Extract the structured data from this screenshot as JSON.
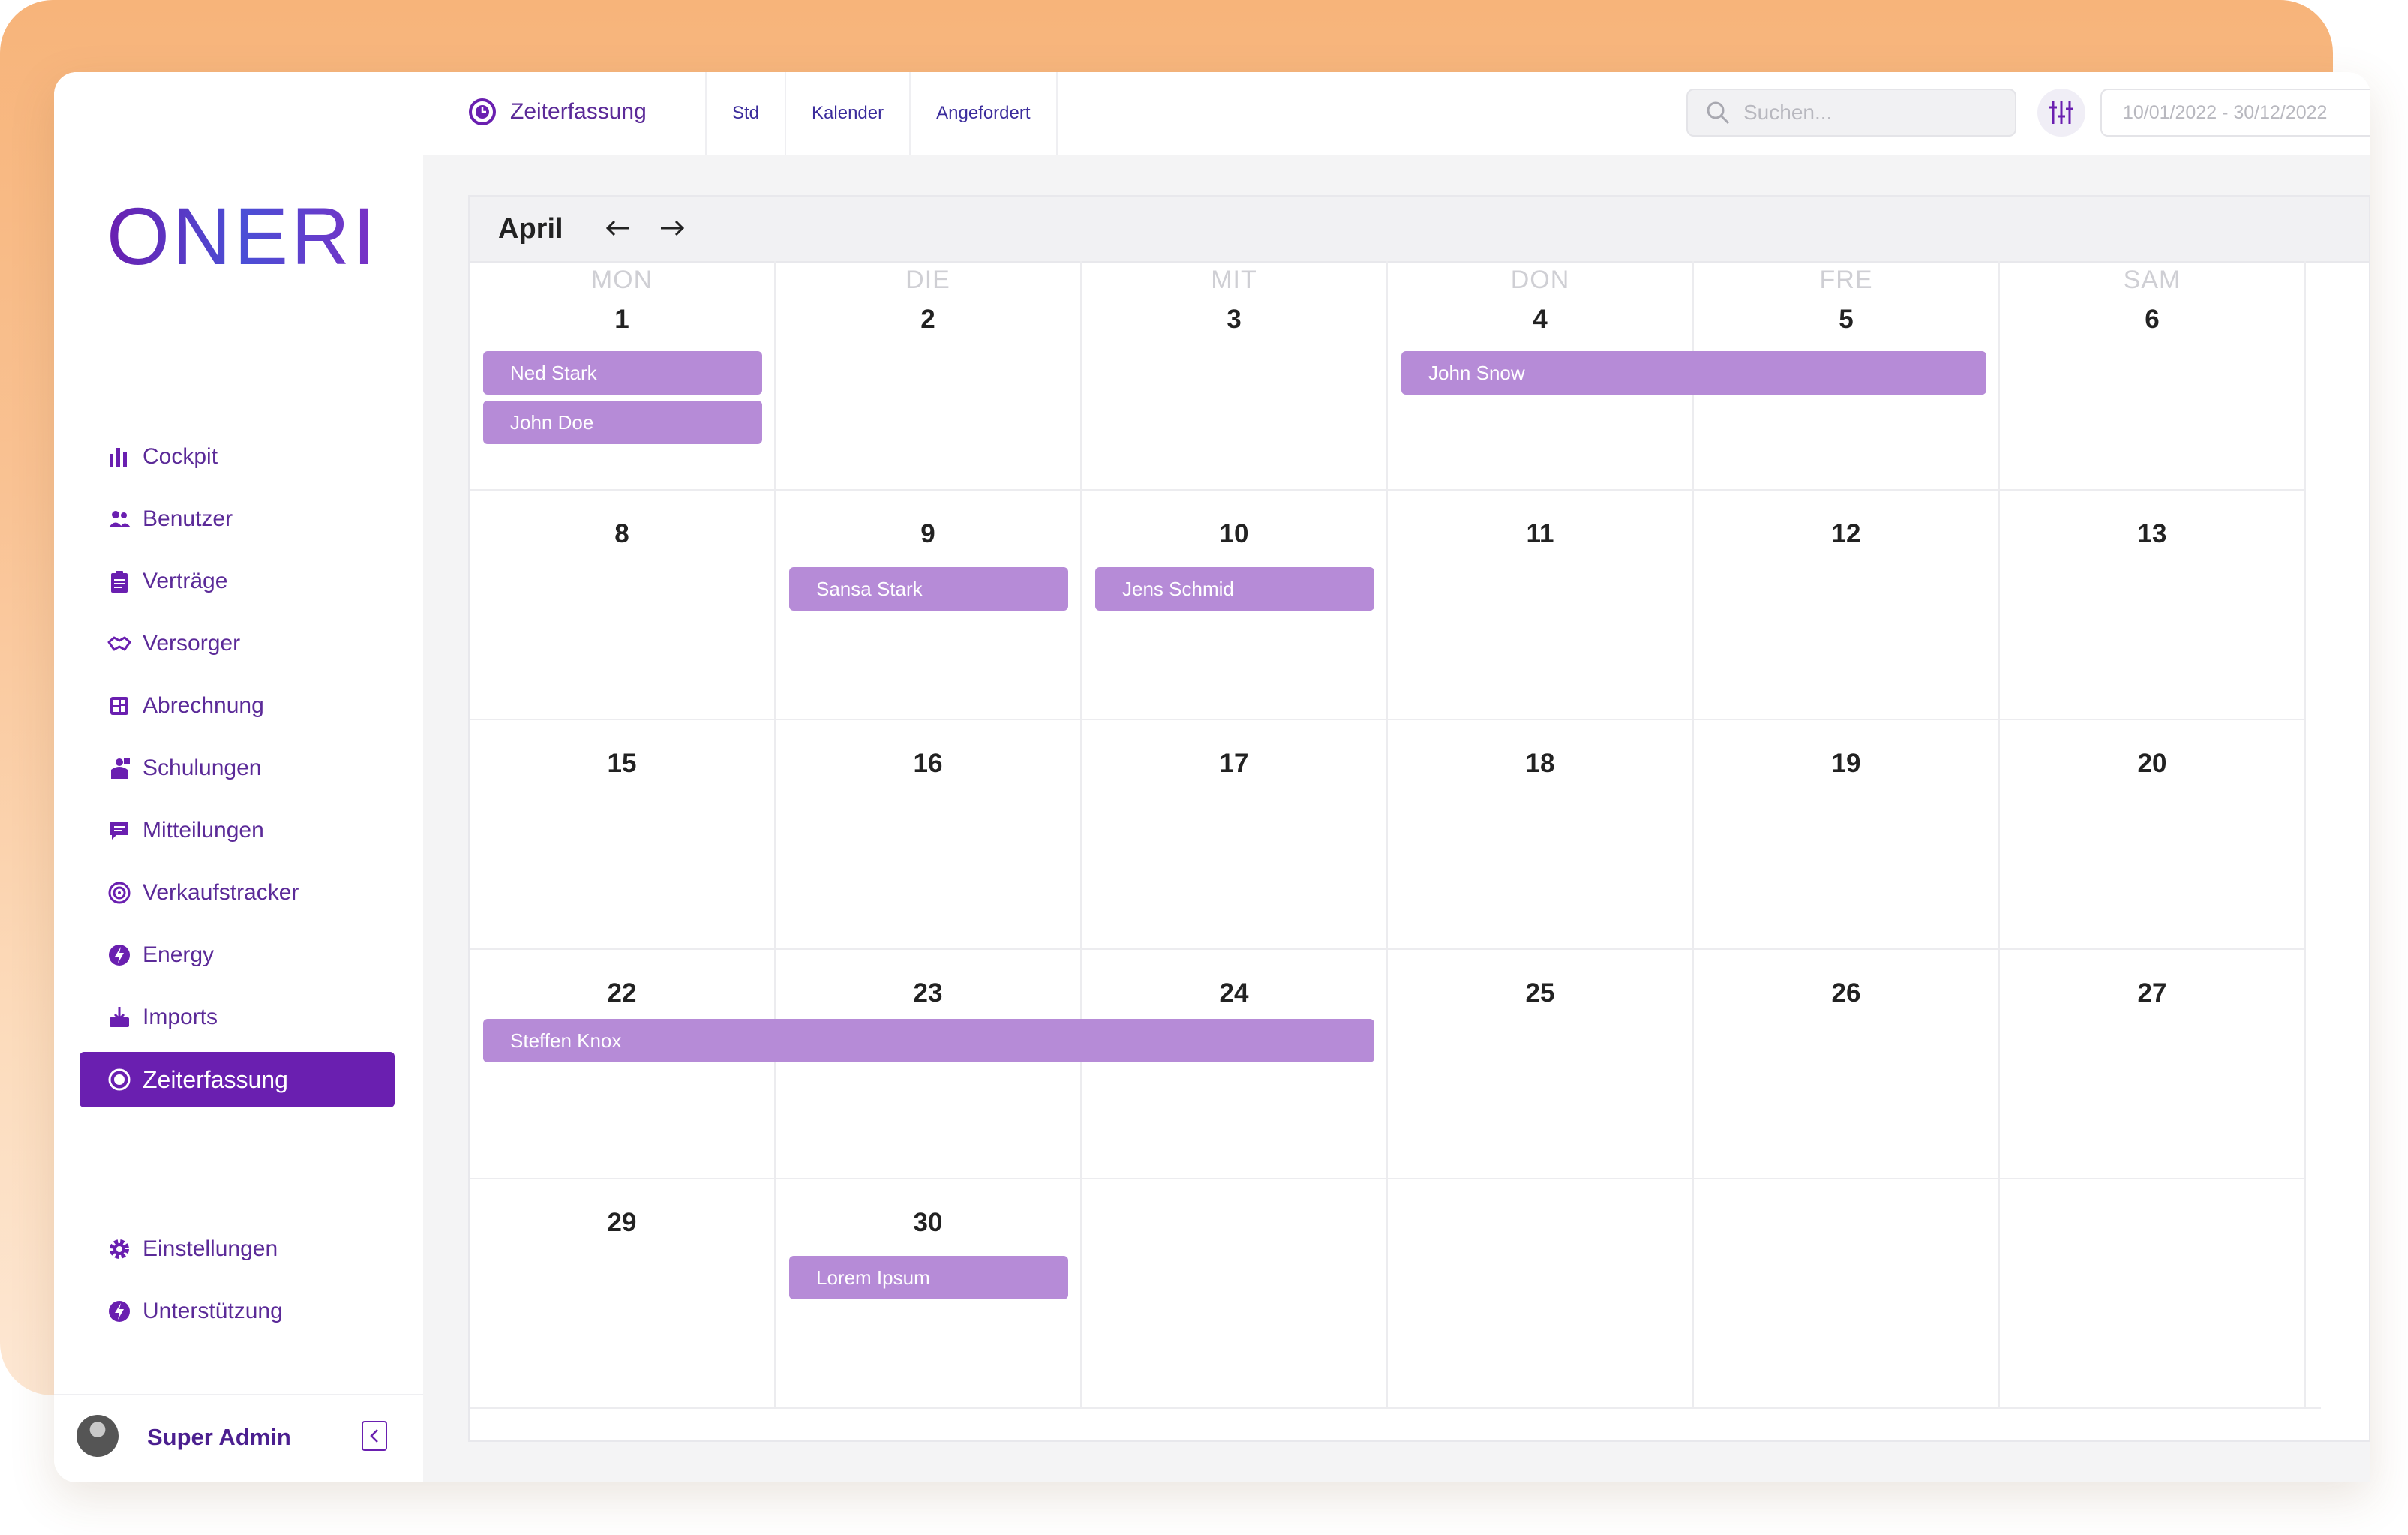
{
  "brand": {
    "logo_text": "ONERI"
  },
  "sidebar": {
    "items": [
      {
        "label": "Cockpit",
        "icon": "bar-chart-icon"
      },
      {
        "label": "Benutzer",
        "icon": "users-icon"
      },
      {
        "label": "Verträge",
        "icon": "clipboard-icon"
      },
      {
        "label": "Versorger",
        "icon": "handshake-icon"
      },
      {
        "label": "Abrechnung",
        "icon": "dashboard-icon"
      },
      {
        "label": "Schulungen",
        "icon": "teacher-icon"
      },
      {
        "label": "Mitteilungen",
        "icon": "message-icon"
      },
      {
        "label": "Verkaufstracker",
        "icon": "target-icon"
      },
      {
        "label": "Energy",
        "icon": "bolt-icon"
      },
      {
        "label": "Imports",
        "icon": "import-icon"
      },
      {
        "label": "Zeiterfassung",
        "icon": "clock-icon",
        "active": true
      }
    ],
    "bottom_items": [
      {
        "label": "Einstellungen",
        "icon": "gear-icon"
      },
      {
        "label": "Unterstützung",
        "icon": "bolt-icon"
      }
    ],
    "user": {
      "name": "Super Admin"
    }
  },
  "header": {
    "title": "Zeiterfassung",
    "tabs": [
      "Std",
      "Kalender",
      "Angefordert"
    ],
    "search_placeholder": "Suchen...",
    "date_range": "10/01/2022 - 30/12/2022"
  },
  "calendar": {
    "month": "April",
    "weekdays": [
      "MON",
      "DIE",
      "MIT",
      "DON",
      "FRE",
      "SAM"
    ],
    "weeks": [
      [
        "1",
        "2",
        "3",
        "4",
        "5",
        "6"
      ],
      [
        "8",
        "9",
        "10",
        "11",
        "12",
        "13"
      ],
      [
        "15",
        "16",
        "17",
        "18",
        "19",
        "20"
      ],
      [
        "22",
        "23",
        "24",
        "25",
        "26",
        "27"
      ],
      [
        "29",
        "30",
        "",
        "",
        "",
        ""
      ]
    ],
    "events": [
      {
        "name": "Ned Stark",
        "week": 0,
        "start": 0,
        "span": 1,
        "slot": 0
      },
      {
        "name": "John Doe",
        "week": 0,
        "start": 0,
        "span": 1,
        "slot": 1
      },
      {
        "name": "John Snow",
        "week": 0,
        "start": 3,
        "span": 2,
        "slot": 0
      },
      {
        "name": "Sansa Stark",
        "week": 1,
        "start": 1,
        "span": 1,
        "slot": 0
      },
      {
        "name": "Jens Schmid",
        "week": 1,
        "start": 2,
        "span": 1,
        "slot": 0
      },
      {
        "name": "Steffen Knox",
        "week": 3,
        "start": 0,
        "span": 3,
        "slot": 0
      },
      {
        "name": "Lorem Ipsum",
        "week": 4,
        "start": 1,
        "span": 1,
        "slot": 0
      }
    ],
    "event_color": "#b68bd7"
  },
  "colors": {
    "accent": "#6a1fb0",
    "nav_text": "#5b2a98",
    "tab_text": "#3b2c9c"
  }
}
